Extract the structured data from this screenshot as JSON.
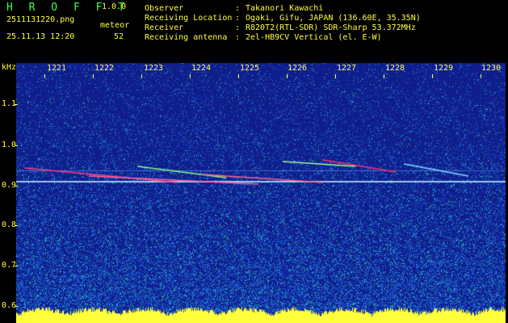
{
  "header": {
    "app_title": "H R O F F T",
    "app_version": "1.0.0",
    "filename": "2511131220.png",
    "datetime": "25.11.13 12:20",
    "meteor_label": "meteor",
    "meteor_count": "52",
    "info": [
      {
        "label": "Observer",
        "value": "Takanori Kawachi"
      },
      {
        "label": "Receiving Location",
        "value": "Ogaki, Gifu, JAPAN (136.60E, 35.35N)"
      },
      {
        "label": "Receiver",
        "value": "R820T2(RTL-SDR) SDR-Sharp 53.372MHz"
      },
      {
        "label": "Receiving antenna",
        "value": "2el-HB9CV Vertical (el. E-W)"
      }
    ],
    "separator": ":"
  },
  "axes": {
    "y_unit": "kHz",
    "y_ticks": [
      "1.1",
      "1.0",
      "0.9",
      "0.8",
      "0.7",
      "0.6"
    ],
    "x_ticks": [
      "1221",
      "1222",
      "1223",
      "1224",
      "1225",
      "1226",
      "1227",
      "1228",
      "1229",
      "1230"
    ]
  },
  "colors": {
    "label_yellow": "#ffff3c",
    "title_green": "#3dff4a",
    "background_blue": "#101e8c"
  }
}
